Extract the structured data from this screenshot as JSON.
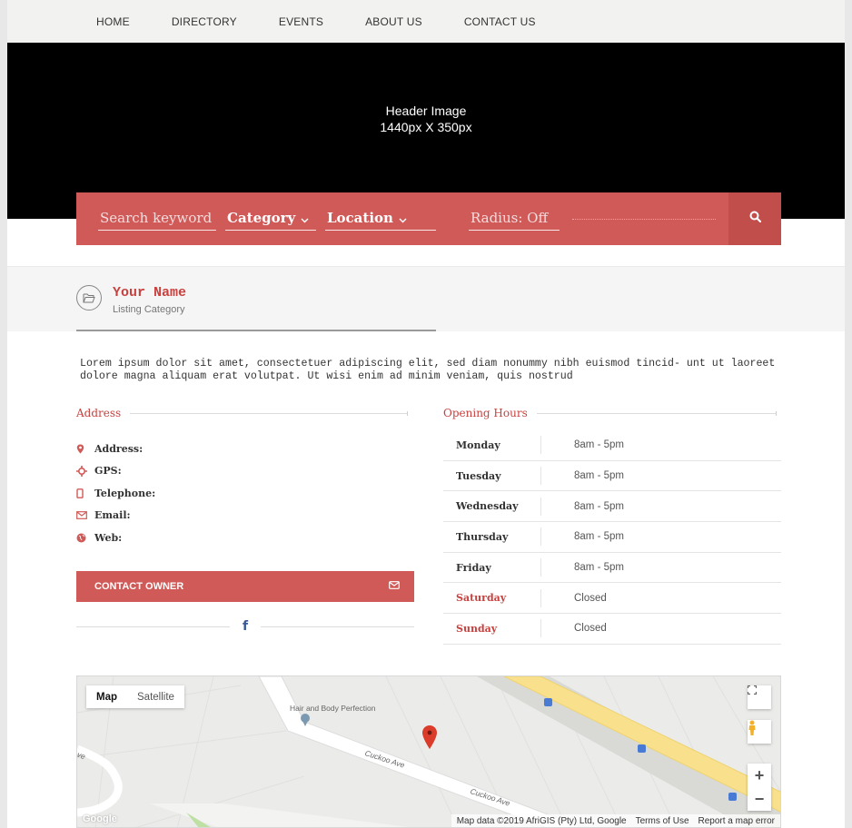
{
  "nav": {
    "items": [
      "HOME",
      "DIRECTORY",
      "EVENTS",
      "ABOUT US",
      "CONTACT US"
    ]
  },
  "header": {
    "line1": "Header Image",
    "line2": "1440px X 350px"
  },
  "search": {
    "keyword": "Search keyword",
    "category": "Category",
    "location": "Location",
    "radius": "Radius: Off",
    "search_icon": "search-icon"
  },
  "listing": {
    "name": "Your Name",
    "category": "Listing Category",
    "description": "Lorem ipsum dolor sit amet, consectetuer adipiscing elit, sed diam nonummy nibh euismod tincid- unt ut laoreet dolore magna aliquam erat volutpat. Ut wisi enim ad minim veniam, quis nostrud"
  },
  "address": {
    "heading": "Address",
    "rows": [
      {
        "label": "Address:",
        "icon": "map-marker-icon"
      },
      {
        "label": "GPS:",
        "icon": "crosshair-icon"
      },
      {
        "label": "Telephone:",
        "icon": "phone-icon"
      },
      {
        "label": "Email:",
        "icon": "envelope-icon"
      },
      {
        "label": "Web:",
        "icon": "globe-icon"
      }
    ],
    "contact_button": "CONTACT OWNER",
    "social": "f"
  },
  "hours": {
    "heading": "Opening Hours",
    "rows": [
      {
        "day": "Monday",
        "time": "8am - 5pm"
      },
      {
        "day": "Tuesday",
        "time": "8am - 5pm"
      },
      {
        "day": "Wednesday",
        "time": "8am - 5pm"
      },
      {
        "day": "Thursday",
        "time": "8am - 5pm"
      },
      {
        "day": "Friday",
        "time": "8am - 5pm"
      },
      {
        "day": "Saturday",
        "time": "Closed"
      },
      {
        "day": "Sunday",
        "time": "Closed"
      }
    ]
  },
  "map": {
    "type_map": "Map",
    "type_satellite": "Satellite",
    "place_label": "Hair and Body Perfection",
    "street1": "Cuckoo Ave",
    "street2": "Cuckoo Ave",
    "street3": "ve",
    "google": "Google",
    "credit": "Map data ©2019 AfriGIS (Pty) Ltd, Google",
    "terms": "Terms of Use",
    "report": "Report a map error",
    "zoom_in": "+",
    "zoom_out": "−"
  },
  "colors": {
    "accent": "#d05a58",
    "accent_text": "#c8413f",
    "header_bg": "#000000"
  }
}
